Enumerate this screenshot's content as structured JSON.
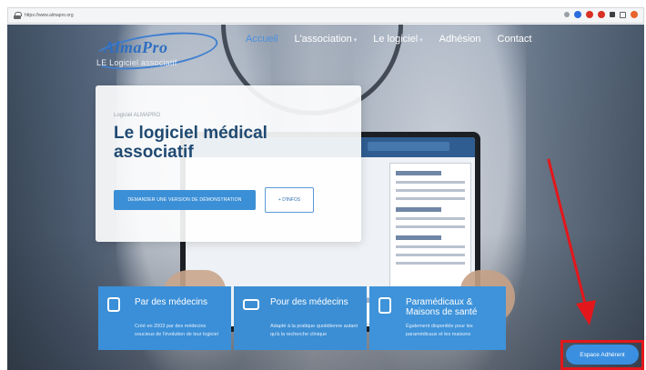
{
  "browser": {
    "url": "https://www.almapro.org"
  },
  "nav": {
    "logo_name": "AlmaPro",
    "logo_tagline": "LE Logiciel associatif",
    "items": [
      {
        "label": "Accueil",
        "active": true,
        "has_dropdown": false
      },
      {
        "label": "L'association",
        "active": false,
        "has_dropdown": true
      },
      {
        "label": "Le logiciel",
        "active": false,
        "has_dropdown": true
      },
      {
        "label": "Adhésion",
        "active": false,
        "has_dropdown": false
      },
      {
        "label": "Contact",
        "active": false,
        "has_dropdown": false
      }
    ]
  },
  "hero": {
    "kicker": "Logiciel ALMAPRO",
    "title": "Le logiciel médical associatif",
    "demo_button": "DEMANDER UNE VERSION DE DÉMONSTRATION",
    "more_button": "+ D'INFOS"
  },
  "features": [
    {
      "title": "Par des médecins",
      "icon": "doctor-icon",
      "text": "Créé en 2003 par des médecins soucieux de l'évolution de leur logiciel"
    },
    {
      "title": "Pour des médecins",
      "icon": "ambulance-icon",
      "text": "Adapté à la pratique quotidienne autant qu'à la recherche clinique"
    },
    {
      "title": "Paramédicaux & Maisons de santé",
      "icon": "clipboard-icon",
      "text": "Également disponible pour les paramédicaux et les maisons"
    }
  ],
  "espace_adherent": "Espace Adhérent",
  "colors": {
    "accent": "#3a8fe0",
    "nav_active": "#4a8fe0",
    "title": "#1f4a72",
    "highlight": "#e3171b"
  }
}
